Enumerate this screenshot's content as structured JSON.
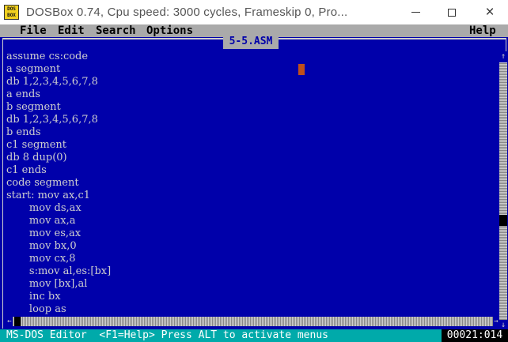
{
  "window": {
    "title": "DOSBox 0.74, Cpu speed:     3000 cycles, Frameskip  0, Pro...",
    "icon_label_top": "DOS",
    "icon_label_bottom": "BOX",
    "icon": "dosbox-icon",
    "controls": {
      "minimize": "minimize-icon",
      "maximize": "maximize-icon",
      "close": "×"
    }
  },
  "menu": {
    "file": "File",
    "edit": "Edit",
    "search": "Search",
    "options": "Options",
    "help": "Help"
  },
  "editor": {
    "filename": "5-5.ASM",
    "lines": [
      "assume cs:code",
      "a segment",
      "db 1,2,3,4,5,6,7,8",
      "a ends",
      "b segment",
      "db 1,2,3,4,5,6,7,8",
      "b ends",
      "c1 segment",
      "db 8 dup(0)",
      "c1 ends",
      "code segment",
      "start: mov ax,c1",
      "       mov ds,ax",
      "       mov ax,a",
      "       mov es,ax",
      "       mov bx,0",
      "       mov cx,8",
      "       s:mov al,es:[bx]",
      "       mov [bx],al",
      "       inc bx",
      "       loop as"
    ]
  },
  "scrollbar": {
    "up": "↑",
    "down": "↓",
    "left": "←",
    "right": "→"
  },
  "status": {
    "text": "MS-DOS Editor  <F1=Help> Press ALT to activate menus",
    "position": "00021:014"
  },
  "colors": {
    "background": "#0000aa",
    "text": "#cfcfcf",
    "menubar": "#aaaaaa",
    "statusbar": "#00aaaa",
    "cursor": "#c0501a"
  }
}
